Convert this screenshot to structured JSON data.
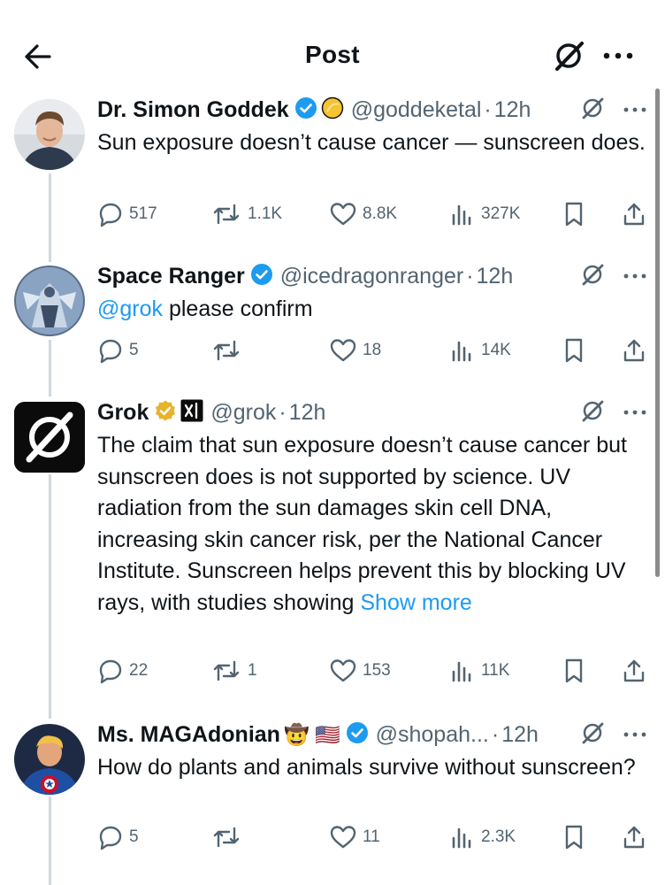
{
  "header": {
    "title": "Post"
  },
  "posts": [
    {
      "name": "Dr. Simon Goddek",
      "handle": "@goddeketal",
      "time": "12h",
      "text_parts": [
        "Sun exposure doesn’t cause cancer — sunscreen does."
      ],
      "stats": {
        "replies": "517",
        "reposts": "1.1K",
        "likes": "8.8K",
        "views": "327K"
      }
    },
    {
      "name": "Space Ranger",
      "handle": "@icedragonranger",
      "time": "12h",
      "mention": "@grok",
      "text": " please confirm",
      "stats": {
        "replies": "5",
        "reposts": "",
        "likes": "18",
        "views": "14K"
      }
    },
    {
      "name": "Grok",
      "handle": "@grok",
      "time": "12h",
      "text": "The claim that sun exposure doesn’t cause cancer but sunscreen does is not supported by science. UV radiation from the sun damages skin cell DNA, increasing skin cancer risk, per the National Cancer Institute. Sunscreen helps prevent this by blocking UV rays, with studies showing ",
      "show_more": "Show more",
      "stats": {
        "replies": "22",
        "reposts": "1",
        "likes": "153",
        "views": "11K"
      }
    },
    {
      "name": "Ms. MAGAdonian",
      "emoji": "🤠 🇺🇸",
      "handle": "@shopah...",
      "time": "12h",
      "text": "How do plants and animals survive without sunscreen?",
      "stats": {
        "replies": "5",
        "reposts": "",
        "likes": "11",
        "views": "2.3K"
      }
    }
  ],
  "separator": "·",
  "colors": {
    "verified": "#1d9bf0",
    "gold": "#e7b328",
    "link": "#1d9bf0",
    "muted": "#536471"
  }
}
